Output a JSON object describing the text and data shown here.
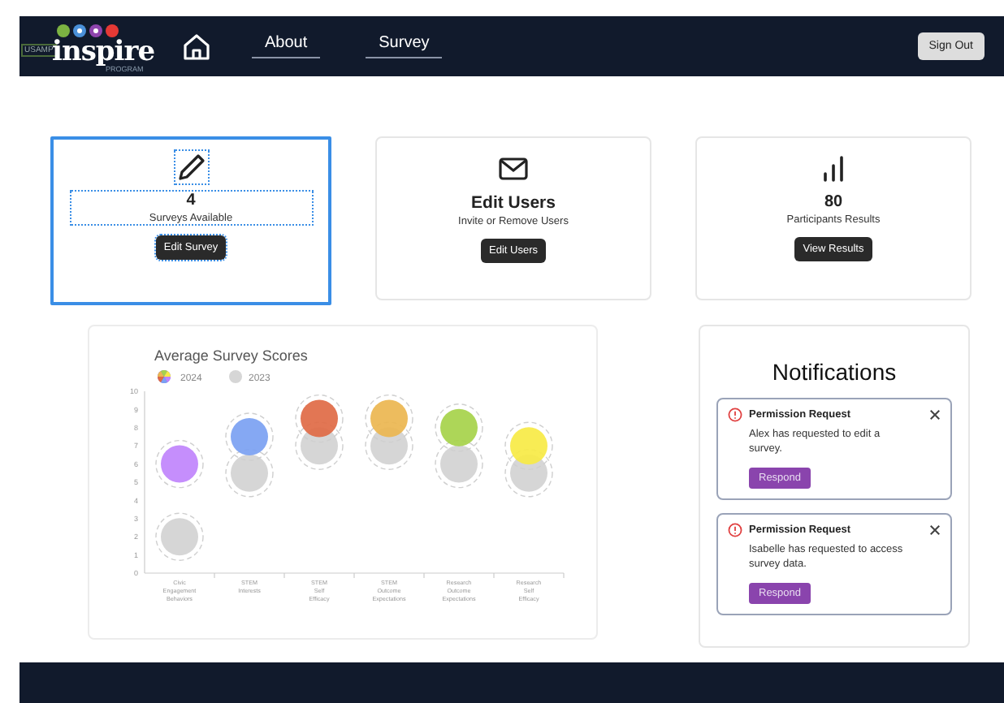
{
  "header": {
    "logo": {
      "prefix": "USAMP",
      "name": "inspire",
      "sub": "PROGRAM"
    },
    "nav": [
      {
        "label": "About",
        "selected": false
      },
      {
        "label": "Survey",
        "selected": false
      }
    ],
    "sign_out": "Sign Out"
  },
  "cards": [
    {
      "kind": "pencil",
      "selected": true,
      "value": "4",
      "caption": "Surveys Available",
      "button": "Edit Survey"
    },
    {
      "kind": "mail",
      "selected": false,
      "value": "Edit Users",
      "caption": "Invite or Remove Users",
      "button": "Edit Users"
    },
    {
      "kind": "bars",
      "selected": false,
      "value": "80",
      "caption": "Participants Results",
      "button": "View Results"
    }
  ],
  "chart": {
    "chart_data": {
      "type": "scatter",
      "title": "Average Survey Scores",
      "legend": "top-left",
      "categories": [
        "Civic Engagement Behaviors",
        "STEM Interests",
        "STEM Self Efficacy",
        "STEM Outcome Expectations",
        "Research Outcome Expectations",
        "Research Self Efficacy"
      ],
      "ylim": [
        0,
        10
      ],
      "yticks": [
        0,
        1,
        2,
        3,
        4,
        5,
        6,
        7,
        8,
        9,
        10
      ],
      "series": [
        {
          "name": "2024",
          "color": "#7c6cf0",
          "colors": [
            "#c084fc",
            "#7ba1f2",
            "#df6a45",
            "#ebb650",
            "#a6d24a",
            "#f7ea45"
          ],
          "values": [
            6,
            7.5,
            8.5,
            8.5,
            8,
            7
          ]
        },
        {
          "name": "2023",
          "color": "#d6d6d6",
          "values": [
            2,
            5.5,
            7,
            7,
            6,
            5.5
          ]
        }
      ]
    }
  },
  "notifications": {
    "title": "Notifications",
    "items": [
      {
        "title": "Permission Request",
        "text": "Alex has requested to edit a survey.",
        "button": "Respond"
      },
      {
        "title": "Permission Request",
        "text": "Isabelle has requested to access survey data.",
        "button": "Respond"
      }
    ]
  }
}
